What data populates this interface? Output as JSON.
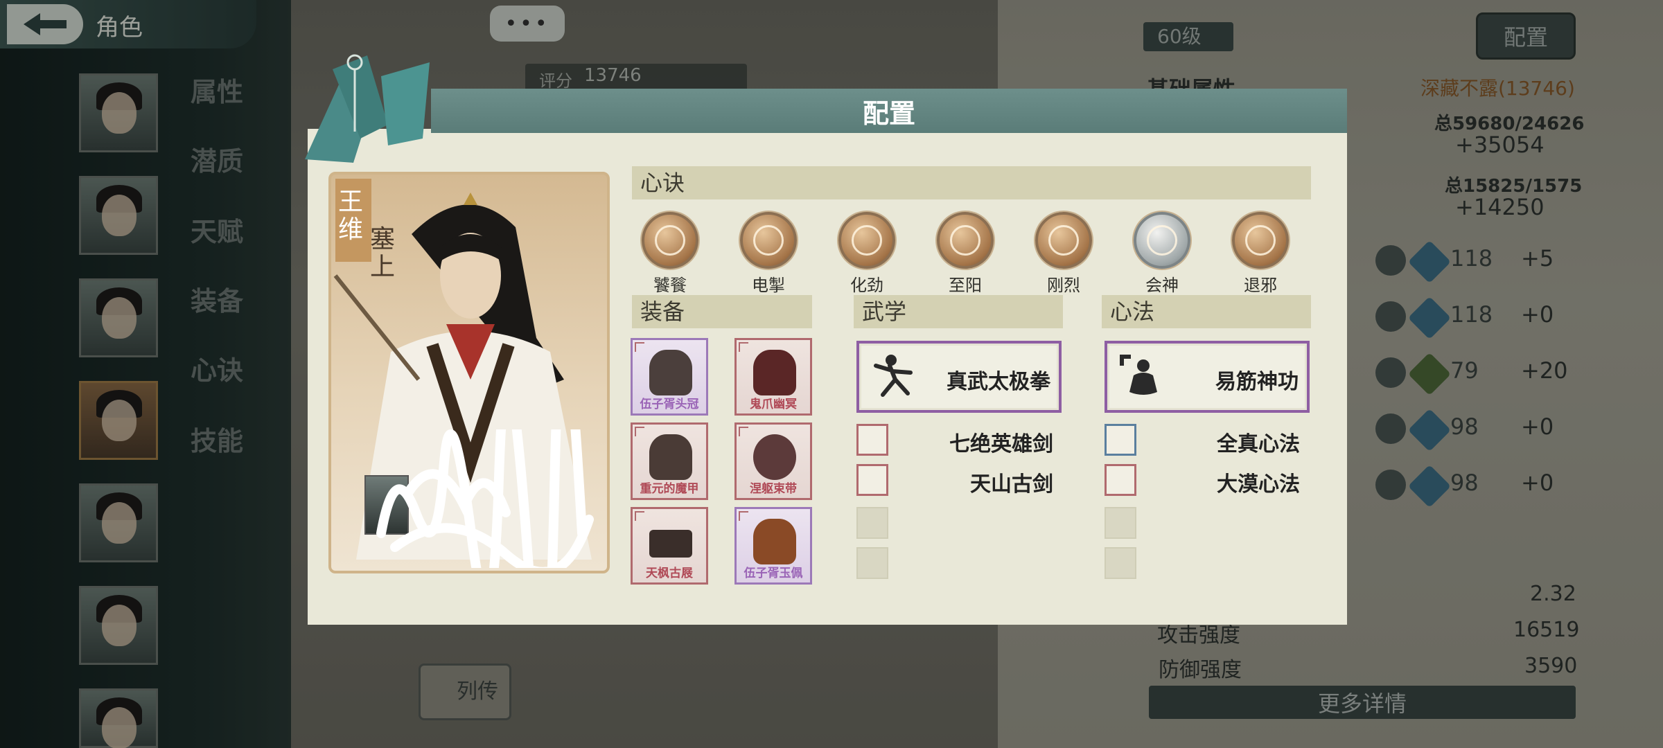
{
  "colors": {
    "modal_bg": "#e9e8d8",
    "modal_header": "#5f817d",
    "section_header": "#d4d1b3",
    "purple_rarity": "#9c79b8",
    "red_rarity": "#b06a6e"
  },
  "background": {
    "page_title": "角色",
    "side_tabs": [
      "属性",
      "潜质",
      "天赋",
      "装备",
      "心诀",
      "技能"
    ],
    "more_button": "•••",
    "score_label": "评分",
    "score_value": "13746",
    "level": "60级",
    "config_button": "配置",
    "attributes_heading": "基础属性",
    "rank": "深藏不露(13746)",
    "total_1": "总59680/24626",
    "bonus_1": "+35054",
    "total_2": "总15825/1575",
    "bonus_2": "+14250",
    "stats": [
      {
        "label_icon": "sword-stat-icon",
        "value": "118",
        "bonus": "+5"
      },
      {
        "label_icon": "trick-stat-icon",
        "value": "118",
        "bonus": "+0"
      },
      {
        "label_icon": "body-stat-icon",
        "value": "79",
        "bonus": "+20"
      },
      {
        "label_icon": "fortune-stat-icon",
        "value": "98",
        "bonus": "+0"
      },
      {
        "label_icon": "focus-stat-icon",
        "value": "98",
        "bonus": "+0"
      }
    ],
    "crit_value": "2.32",
    "attack_label": "攻击强度",
    "attack_value": "16519",
    "defense_label": "防御强度",
    "defense_value": "3590",
    "more_details": "更多详情",
    "biography": "列传"
  },
  "modal": {
    "title": "配置",
    "character": {
      "name": "王维",
      "subtitle": "塞上"
    },
    "sections": {
      "mind": "心诀",
      "equipment": "装备",
      "martial": "武学",
      "method": "心法"
    },
    "skills": [
      {
        "name": "饕餮",
        "icon": "beast-icon"
      },
      {
        "name": "电掣",
        "icon": "lightning-icon"
      },
      {
        "name": "化劲",
        "icon": "swirl-icon"
      },
      {
        "name": "至阳",
        "icon": "sun-icon"
      },
      {
        "name": "刚烈",
        "icon": "tiger-icon"
      },
      {
        "name": "会神",
        "icon": "spirit-icon"
      },
      {
        "name": "退邪",
        "icon": "talisman-icon"
      }
    ],
    "equipment": [
      {
        "name": "伍子胥头冠",
        "rarity": "purple"
      },
      {
        "name": "鬼爪幽冥",
        "rarity": "red"
      },
      {
        "name": "重元的魔甲",
        "rarity": "red"
      },
      {
        "name": "涅躯束带",
        "rarity": "red"
      },
      {
        "name": "天枫古屐",
        "rarity": "red"
      },
      {
        "name": "伍子胥玉佩",
        "rarity": "purple"
      }
    ],
    "martial": {
      "featured": "真武太极拳",
      "items": [
        "七绝英雄剑",
        "天山古剑"
      ]
    },
    "method": {
      "featured": "易筋神功",
      "items": [
        "全真心法",
        "大漠心法"
      ]
    }
  }
}
